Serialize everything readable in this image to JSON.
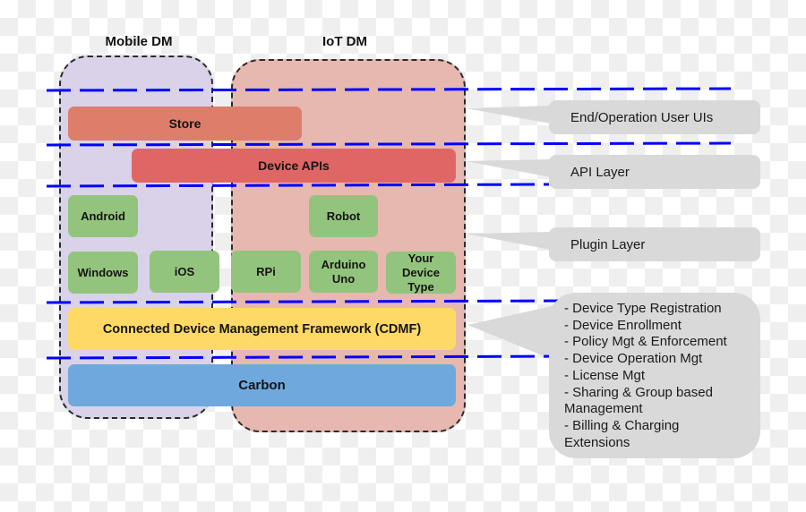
{
  "groups": {
    "mobile": {
      "title": "Mobile DM",
      "fill": "#d9d2e9"
    },
    "iot": {
      "title": "IoT DM",
      "fill": "#e6b8af"
    }
  },
  "layers": {
    "store": {
      "label": "Store",
      "color": "#dd7e6b"
    },
    "device_apis": {
      "label": "Device APIs",
      "color": "#e06666"
    },
    "plugins": {
      "color": "#93c47d",
      "items": [
        {
          "label": "Android"
        },
        {
          "label": "Windows"
        },
        {
          "label": "iOS"
        },
        {
          "label": "Robot"
        },
        {
          "label": "RPi"
        },
        {
          "label": "Arduino Uno"
        },
        {
          "label": "Your Device Type"
        }
      ]
    },
    "cdmf": {
      "label": "Connected Device Management Framework (CDMF)",
      "color": "#ffd966"
    },
    "carbon": {
      "label": "Carbon",
      "color": "#6fa8dc"
    }
  },
  "callouts": {
    "ui": "End/Operation User UIs",
    "api": "API Layer",
    "plugin": "Plugin Layer",
    "cdmf_features": [
      "- Device Type Registration",
      "- Device Enrollment",
      "- Policy Mgt & Enforcement",
      "- Device Operation Mgt",
      "- License Mgt",
      "- Sharing & Group based Management",
      "- Billing & Charging Extensions"
    ]
  },
  "colors": {
    "layer_divider": "#0000ff",
    "callout_fill": "#d9d9d9"
  }
}
